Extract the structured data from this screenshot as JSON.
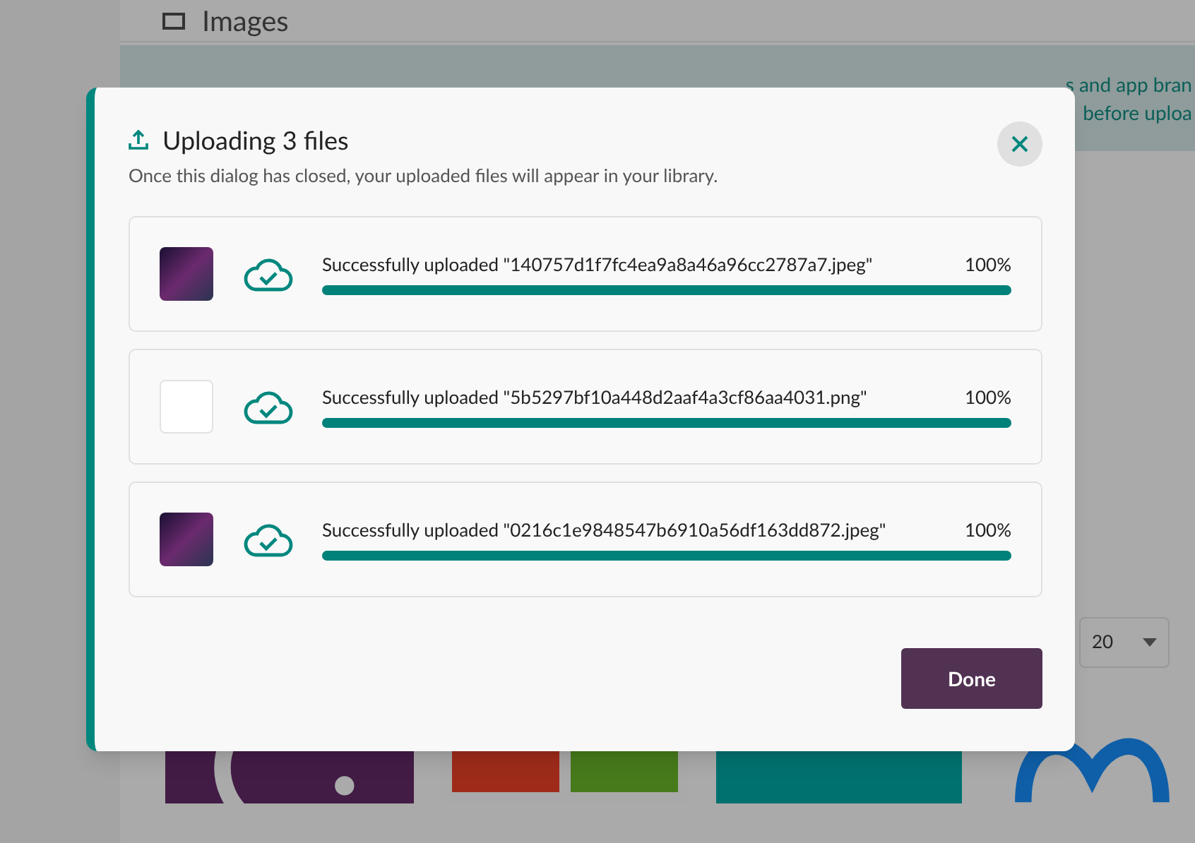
{
  "page": {
    "heading": "Images",
    "banner_lines": [
      "s and app bran",
      "before uploa"
    ],
    "page_size": "20"
  },
  "dialog": {
    "title": "Uploading 3 files",
    "subtitle": "Once this dialog has closed, your uploaded files will appear in your library.",
    "files": [
      {
        "kind": "photo",
        "message": "Successfully uploaded \"140757d1f7fc4ea9a8a46a96cc2787a7.jpeg\"",
        "percent": "100%",
        "level": 1
      },
      {
        "kind": "blank",
        "message": "Successfully uploaded \"5b5297bf10a448d2aaf4a3cf86aa4031.png\"",
        "percent": "100%",
        "level": 1
      },
      {
        "kind": "photo",
        "message": "Successfully uploaded \"0216c1e9848547b6910a56df163dd872.jpeg\"",
        "percent": "100%",
        "level": 1
      }
    ],
    "done_button": "Done"
  }
}
